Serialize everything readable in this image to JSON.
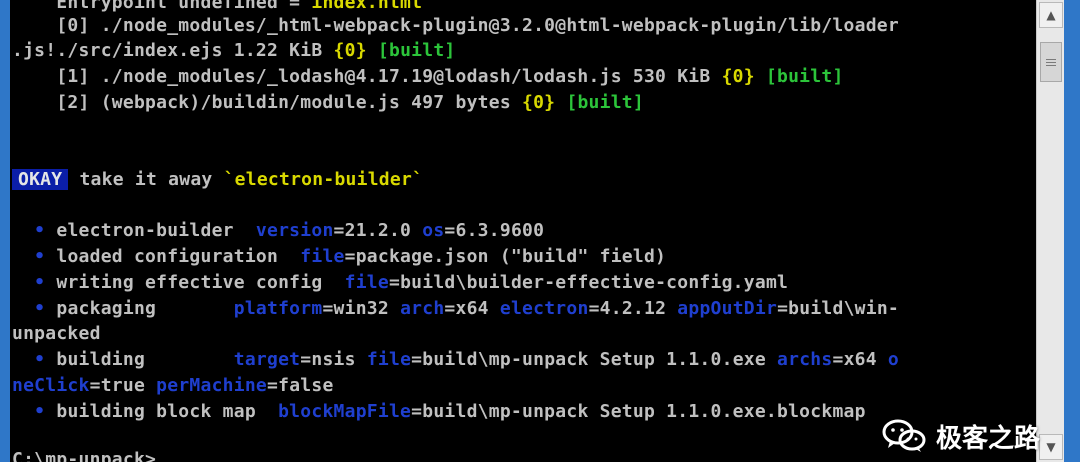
{
  "colors": {
    "background": "#000000",
    "text": "#c0c0c0",
    "yellow": "#d9d900",
    "green": "#2cc43a",
    "blue": "#1f3fcf",
    "okay_bg": "#0b1ea8",
    "window_border": "#2f77c8"
  },
  "terminal": {
    "top_cut_prefix": "    Entrypoint undefined = ",
    "top_cut_file": "index.html",
    "chunk0_a": "    [0] ./node_modules/_html-webpack-plugin@3.2.0@html-webpack-plugin/lib/loader",
    "chunk0_b": ".js!./src/index.ejs 1.22 KiB ",
    "chunk0_b_id": "{0}",
    "built": "[built]",
    "chunk1": "    [1] ./node_modules/_lodash@4.17.19@lodash/lodash.js 530 KiB ",
    "chunk1_id": "{0}",
    "chunk2": "    [2] (webpack)/buildin/module.js 497 bytes ",
    "chunk2_id": "{0}",
    "okay_badge": "OKAY",
    "okay_msg": " take it away ",
    "okay_quote": "`electron-builder`",
    "bullet": "  •",
    "b1_label": " electron-builder  ",
    "b1_k1": "version",
    "b1_v1": "=21.2.0 ",
    "b1_k2": "os",
    "b1_v2": "=6.3.9600",
    "b2_label": " loaded configuration  ",
    "b2_k1": "file",
    "b2_v1": "=package.json (\"build\" field)",
    "b3_label": " writing effective config  ",
    "b3_k1": "file",
    "b3_v1": "=build\\builder-effective-config.yaml",
    "b4_label": " packaging       ",
    "b4_k1": "platform",
    "b4_v1": "=win32 ",
    "b4_k2": "arch",
    "b4_v2": "=x64 ",
    "b4_k3": "electron",
    "b4_v3": "=4.2.12 ",
    "b4_k4": "appOutDir",
    "b4_v4": "=build\\win-",
    "b4_wrap": "unpacked",
    "b5_label": " building        ",
    "b5_k1": "target",
    "b5_v1": "=nsis ",
    "b5_k2": "file",
    "b5_v2": "=build\\mp-unpack Setup 1.1.0.exe ",
    "b5_k3": "archs",
    "b5_v3": "=x64 ",
    "b5_k4a": "o",
    "b5_k4b": "neClick",
    "b5_v4": "=true ",
    "b5_k5": "perMachine",
    "b5_v5": "=false",
    "b6_label": " building block map  ",
    "b6_k1": "blockMapFile",
    "b6_v1": "=build\\mp-unpack Setup 1.1.0.exe.blockmap",
    "prompt": "C:\\mp-unpack>"
  },
  "scrollbar": {
    "up_icon": "scroll-up-arrow",
    "down_icon": "scroll-down-arrow"
  },
  "watermark": {
    "icon": "wechat-icon",
    "text": "极客之路"
  }
}
